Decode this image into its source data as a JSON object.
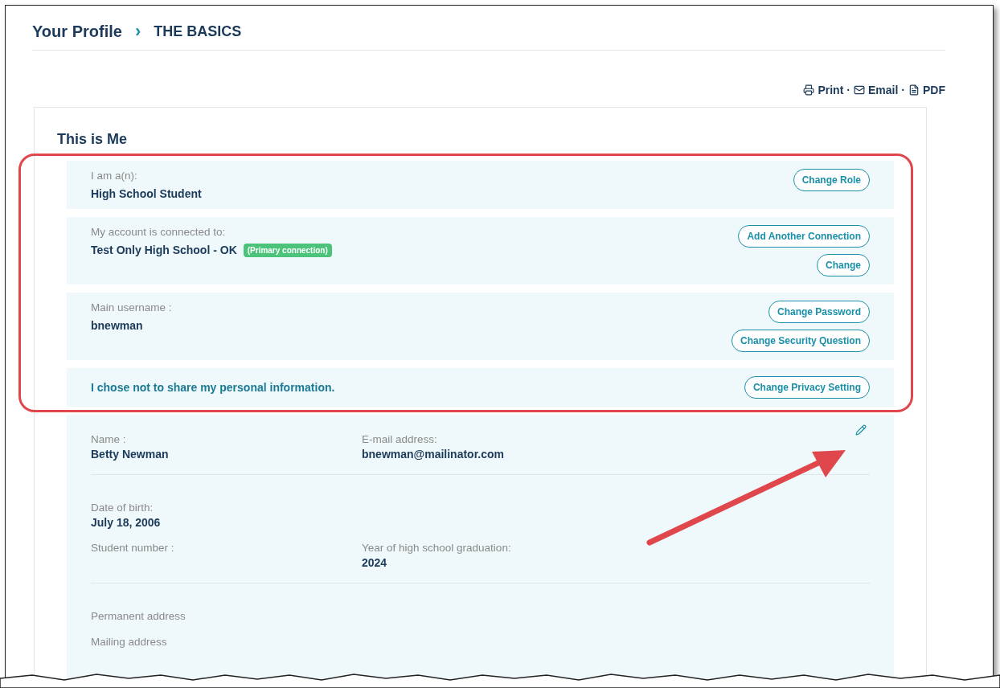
{
  "breadcrumb": {
    "parent": "Your Profile",
    "separator": "›",
    "current": "THE BASICS"
  },
  "share_links": [
    {
      "kind": "print",
      "label": "Print"
    },
    {
      "kind": "email",
      "label": "Email"
    },
    {
      "kind": "pdf",
      "label": "PDF"
    }
  ],
  "share_separator": "·",
  "card": {
    "title": "This is Me",
    "sections": [
      {
        "label": "I am a(n):",
        "value": "High School Student",
        "buttons": [
          "Change Role"
        ]
      },
      {
        "label": "My account is connected to:",
        "value": "Test Only High School - OK",
        "badge": "(Primary connection)",
        "buttons": [
          "Add Another Connection",
          "Change"
        ]
      },
      {
        "label": "Main username :",
        "value": "bnewman",
        "buttons": [
          "Change Password",
          "Change Security Question"
        ]
      },
      {
        "note": "I chose not to share my personal information.",
        "buttons": [
          "Change Privacy Setting"
        ]
      }
    ],
    "details": {
      "groups": [
        [
          [
            {
              "label": "Name :",
              "value": "Betty Newman"
            },
            {
              "label": "E-mail address:",
              "value": "bnewman@mailinator.com"
            }
          ]
        ],
        [
          [
            {
              "label": "Date of birth:",
              "value": "July 18, 2006"
            }
          ],
          [
            {
              "label": "Student number :"
            },
            {
              "label": "Year of high school graduation:",
              "value": "2024"
            }
          ]
        ],
        [
          [
            {
              "label": "Permanent address"
            }
          ],
          [
            {
              "label": "Mailing address"
            }
          ]
        ]
      ]
    }
  }
}
